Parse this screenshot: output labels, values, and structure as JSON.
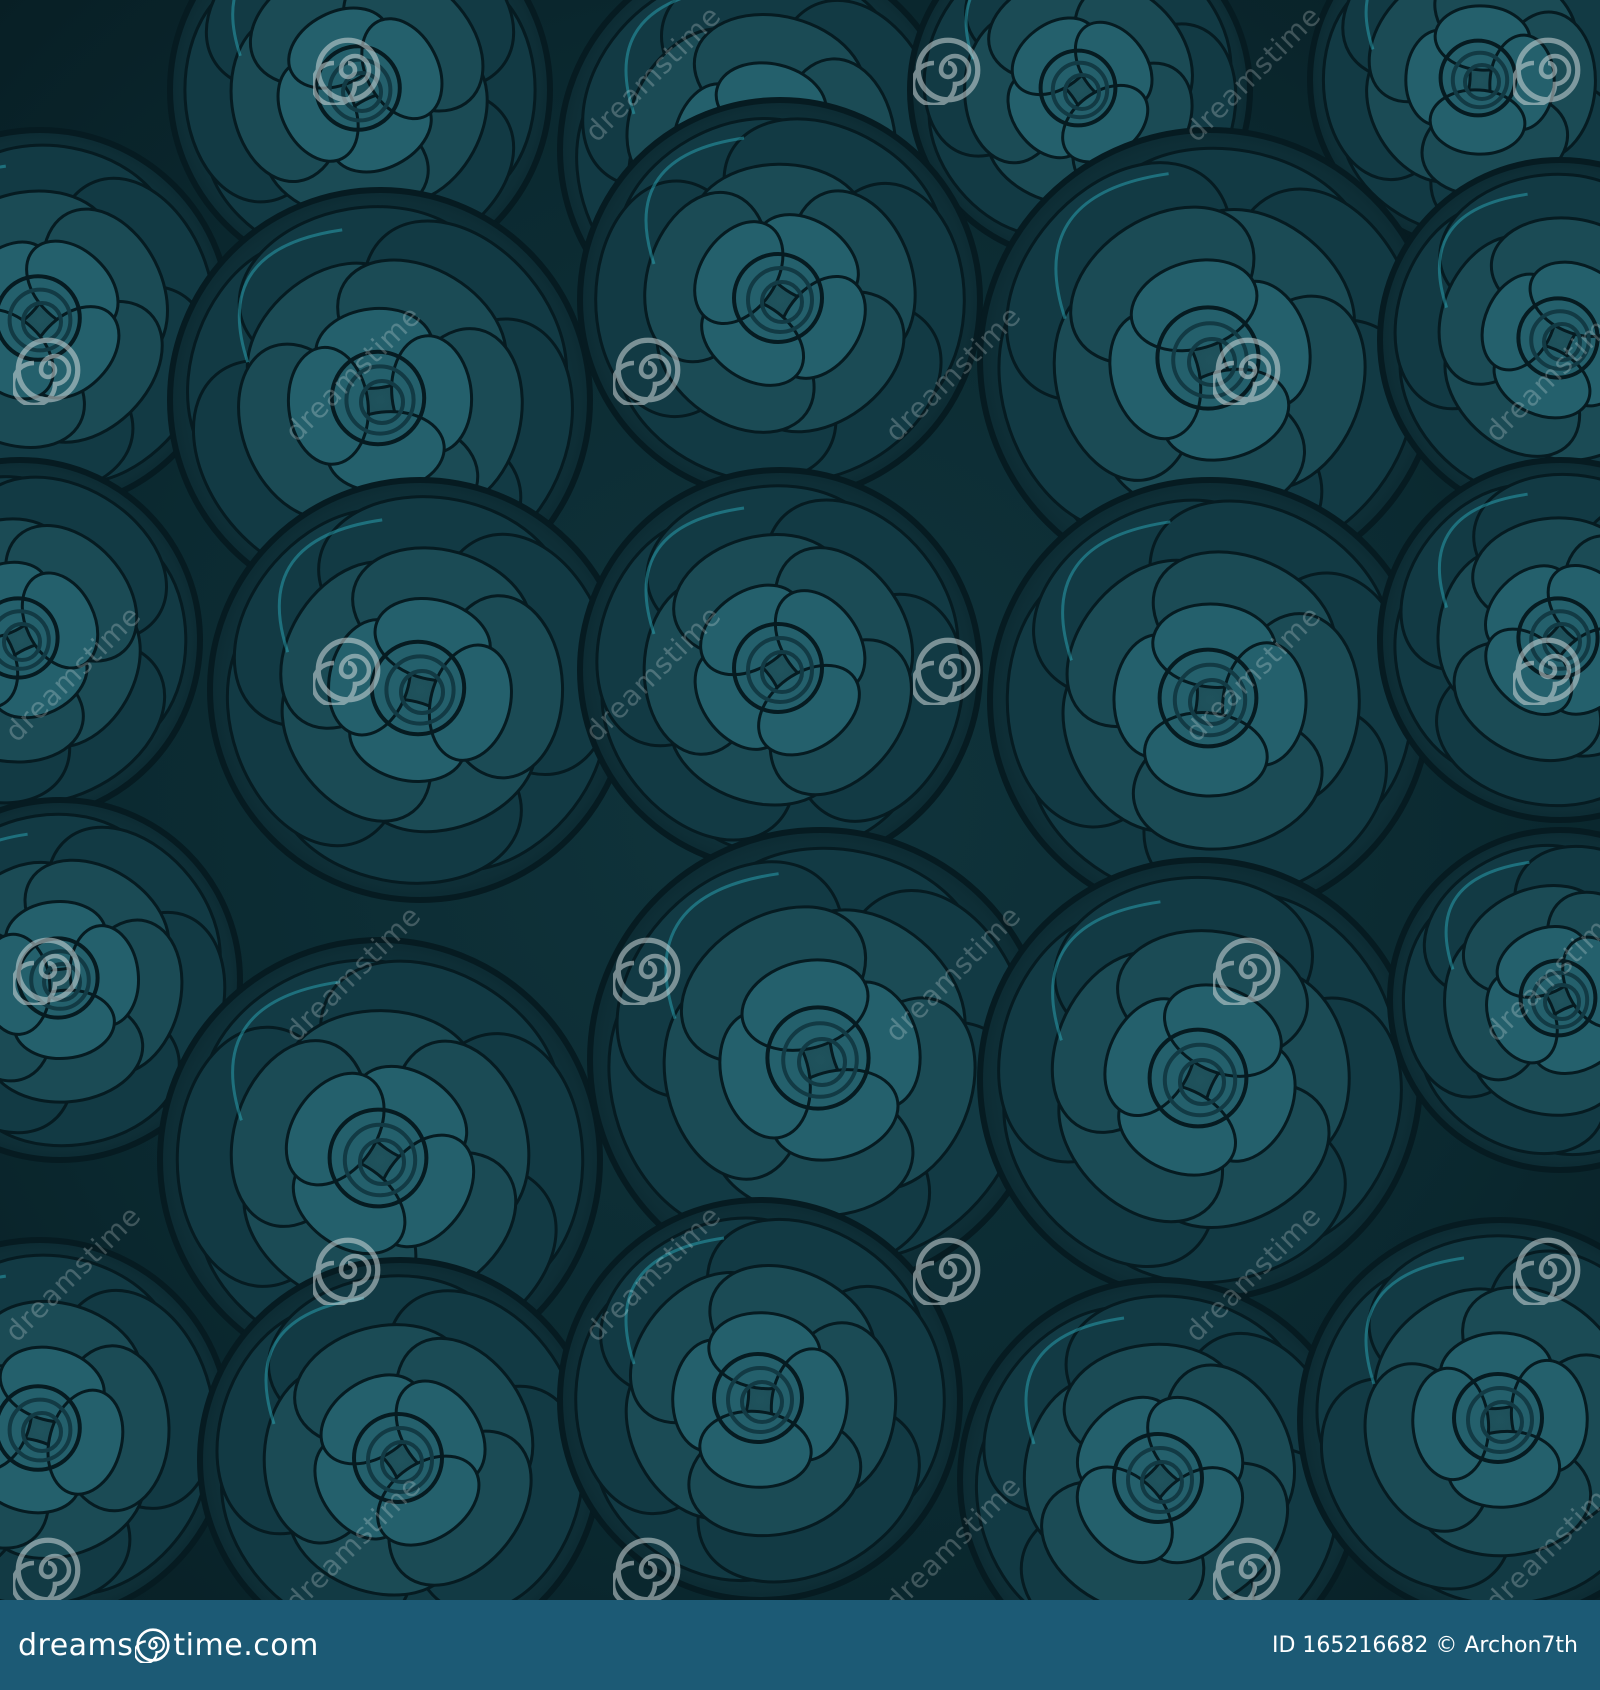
{
  "image": {
    "palette": {
      "background": "#0b2a31",
      "rose_base": "#123a44",
      "rose_mid": "#1b4b55",
      "rose_light": "#24606c",
      "rose_shadow": "#061b21",
      "highlight": "#2fb3c4"
    },
    "watermark": {
      "text": "dreamstime",
      "icon": "spiral-icon"
    }
  },
  "footer": {
    "brand_prefix": "dreams",
    "brand_suffix": "time.com",
    "credit": "ID 165216682 © Archon7th",
    "background": "#1c5a75"
  }
}
